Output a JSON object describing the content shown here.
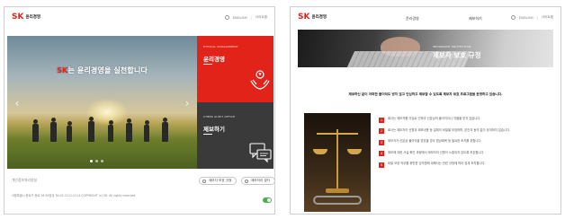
{
  "common": {
    "logo_mark": "SK",
    "logo_text": "윤리경영",
    "lang": "ENGLISH",
    "sitemap": "사이트맵"
  },
  "left": {
    "hero_accent": "SK",
    "hero_title_rest": "는 윤리경영을 실천합니다",
    "panel1_eng": "ETHICAL MANAGEMENT",
    "panel1_title": "윤리경영",
    "panel2_eng": "CYBER AUDIT OFFICE",
    "panel2_title": "제보하기",
    "link_text": "개인정보처리방침",
    "footer": "서울특별시 종로구 종로 26 SK빌딩 Tel.02-2121-0114 COPYRIGHT (c) SK. All rights reserved.",
    "pill1": "제보자 보호 규정",
    "pill2": "제보처리 절차"
  },
  "right": {
    "nav": [
      "윤리경영",
      "제보하기"
    ],
    "banner_eng": "INFORMANT PROTECTION",
    "banner_title": "제보자 보호 규정",
    "intro": "제보하신 분이 어떠한 불이익도 받지 않고 안심하고 제보할 수 있도록 제보자 보호 프로그램을 운영하고 있습니다.",
    "items": [
      {
        "num": "1",
        "text": "회사는 제보자를 이유로 인하여 신분상의 불이익이나 차별을 받지 않습니다."
      },
      {
        "num": "2",
        "text": "회사는 제보자의 신원과 제보내용 등 일체의 비밀을 보장하며, 본인의 동의 없이 공개하지 않습니다."
      },
      {
        "num": "3",
        "text": "제보자가 신분상 불이익을 받았을 경우 원상회복 등 필요한 조치를 취합니다."
      },
      {
        "num": "4",
        "text": "제보에 대한 사실 확인 과정에서 제보자의 신원이 노출되지 않도록 보호합니다."
      },
      {
        "num": "5",
        "text": "비밀 보장 의무를 위반한 임직원에 대해서는 관련 규정에 따라 징계 조치합니다."
      }
    ]
  },
  "colors": {
    "brand_red": "#e2231a",
    "dark_panel": "#3a3a3a",
    "toggle_green": "#4caf50"
  }
}
